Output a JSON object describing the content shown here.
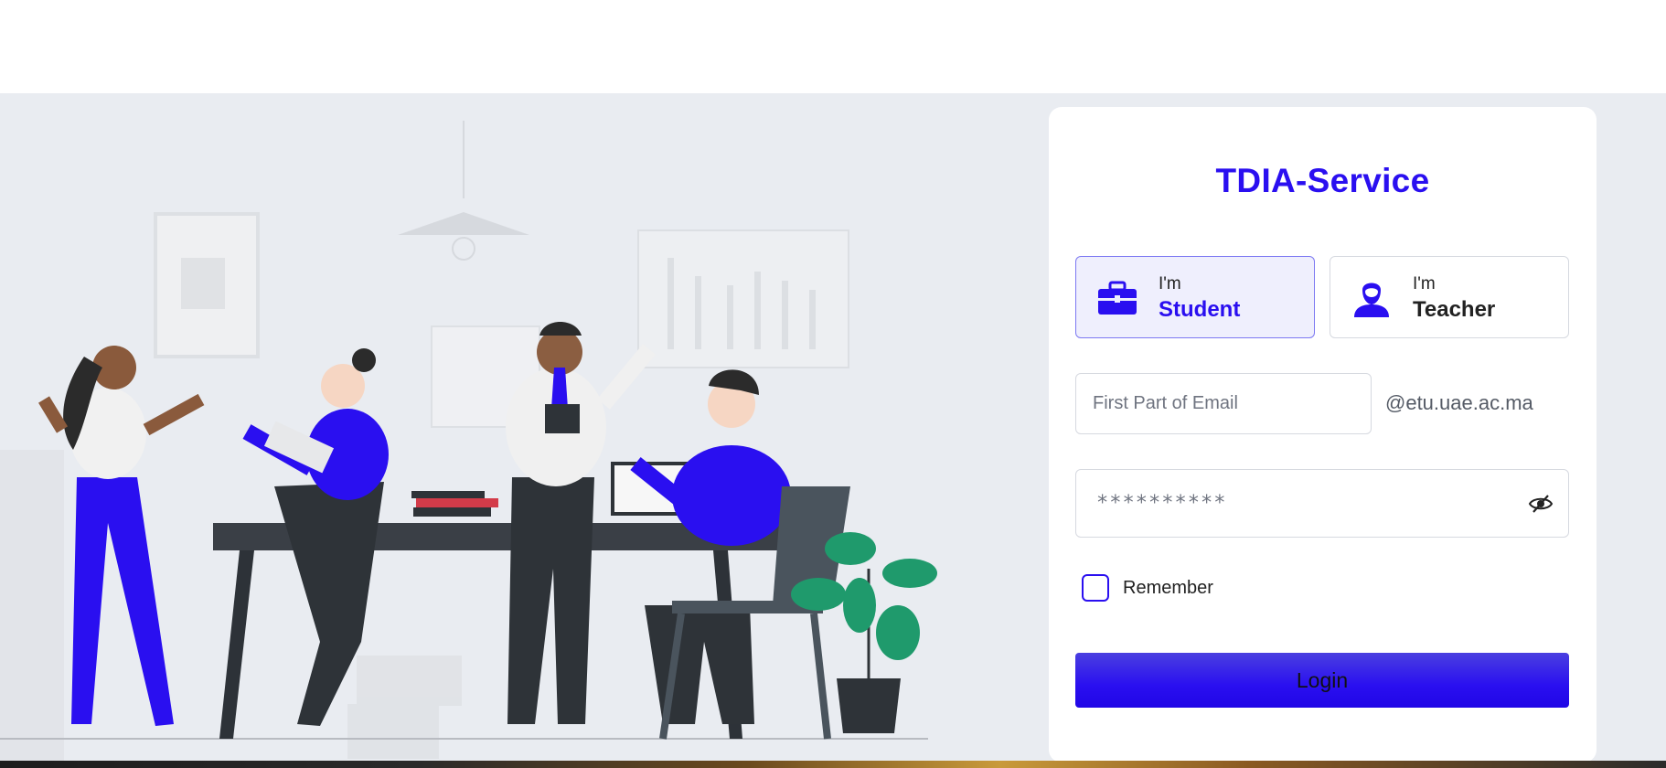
{
  "header": {},
  "login_card": {
    "brand_title": "TDIA-Service",
    "roles": [
      {
        "prefix": "I'm",
        "name": "Student",
        "icon": "briefcase-icon",
        "selected": true
      },
      {
        "prefix": "I'm",
        "name": "Teacher",
        "icon": "person-icon",
        "selected": false
      }
    ],
    "email": {
      "placeholder": "First Part of Email",
      "value": "",
      "domain_suffix": "@etu.uae.ac.ma"
    },
    "password": {
      "placeholder": "**********",
      "value": "",
      "toggle_icon": "eye-slash-icon"
    },
    "remember_label": "Remember",
    "remember_checked": false,
    "login_label": "Login"
  },
  "colors": {
    "accent": "#2a0ff0",
    "background": "#e9ecf1",
    "card": "#ffffff",
    "selected_role_bg": "#efeffd"
  }
}
